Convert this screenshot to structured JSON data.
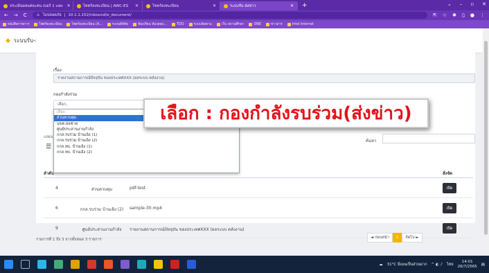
{
  "browser": {
    "tabs": [
      {
        "label": "ประเมินผลแต่ละคน เบอร์ 1 vdo",
        "active": false
      },
      {
        "label": "ไซตร์ลงทะเบียน | AWC-ES",
        "active": false
      },
      {
        "label": "ไซตร์ลงทะเบียน",
        "active": false
      },
      {
        "label": "ระบบรับ-ส่งข่าว",
        "active": true
      }
    ],
    "url": "10.1.1.152/inbound/e_document/",
    "url_prefix": "ไม่ปลอดภัย",
    "bookmarks": [
      "หนังสือราชการ",
      "ไซตร์ลงทะเบียน",
      "ไซตร์ลงทะเบียน (A...",
      "ระบบดิจิทัล",
      "ห้องเรียน ห้องสอบ...",
      "TDO",
      "ระบบติดตาม",
      "เว็บ สถานศึกษา",
      "ONE",
      "ข่าวสาร",
      "Intel Internet"
    ]
  },
  "page": {
    "header_title": "ระบบรับ-ส่งข่าว",
    "subject_label": "เรื่อง",
    "subject_value": "รายงานสถานการณ์ปัจจุบัน ของประเทศXXX (ผลระบบ คลังงาน)",
    "force_label": "กองกำลังร่วม",
    "select_placeholder": "เลือก..",
    "dropdown_options": [
      {
        "label": "เลือก",
        "state": "dim"
      },
      {
        "label": "ส่วนควบคุม",
        "state": "selected"
      },
      {
        "label": "นขต.ผ่อซ่าด",
        "state": ""
      },
      {
        "label": "ศูนย์ประสานงานกำลัง",
        "state": ""
      },
      {
        "label": "กกล.รบร่วม บ้านเอิง (1)",
        "state": ""
      },
      {
        "label": "กกล.รบร่วม บ้านเอิง (2)",
        "state": ""
      },
      {
        "label": "กกล.ทบ. บ้านเอิง (1)",
        "state": ""
      },
      {
        "label": "กกล.ทบ. บ้านเอิง (2)",
        "state": ""
      }
    ],
    "search_label": "ค้นหา",
    "left_cut_label": "แสดง",
    "header_action": "สั่งจัด",
    "header_col1": "ลำดับ",
    "rows": [
      {
        "num": "4",
        "group": "ส่วนควบคุม",
        "file": "pdf-test",
        "action": "เปิด"
      },
      {
        "num": "6",
        "group": "กกล.รบร่วม บ้านเอิง (2)",
        "file": "sample-30.mp4",
        "action": "เปิด"
      },
      {
        "num": "9",
        "group": "ศูนย์ประสานงานกำลัง",
        "file": "รายงานสถานการณ์ปัจจุบัน ของประเทศXXX (ผลระบบ คลังงาน)",
        "action": "เปิด"
      }
    ],
    "info_text": "รายการที่ 1 ถึง 3 จากทั้งหมด 3 รายการ",
    "pager": {
      "prev": "◄ ก่อนหน้า",
      "current": "1",
      "next": "ถัดไป ►"
    }
  },
  "caption": "เลือก : กองกำลังรบร่วม(ส่งข่าว)",
  "taskbar": {
    "weather": "31°C มีเมฆเป็นส่วนมาก",
    "lang": "ไทย",
    "time": "14:01",
    "date": "26/7/2565"
  },
  "colors": {
    "tabbar": "#5b2aa6",
    "addrbar": "#6a35b8",
    "bookmarks": "#7d49c8",
    "selected_option": "#2b74d6",
    "caption_text": "#e3131a",
    "pager_current": "#f2b600",
    "taskbar": "#12233b"
  }
}
